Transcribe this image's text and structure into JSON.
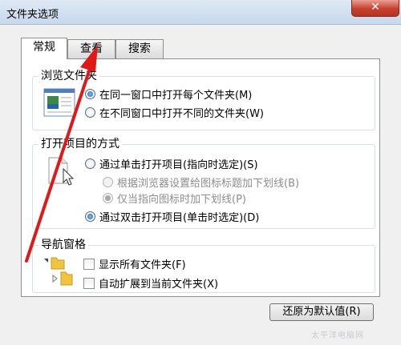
{
  "window": {
    "title": "文件夹选项",
    "close_glyph": "✕"
  },
  "tabs": [
    {
      "label": "常规",
      "active": true
    },
    {
      "label": "查看",
      "active": false
    },
    {
      "label": "搜索",
      "active": false
    }
  ],
  "browse_group": {
    "legend": "浏览文件夹",
    "options": [
      {
        "label": "在同一窗口中打开每个文件夹(M)",
        "selected": true
      },
      {
        "label": "在不同窗口中打开不同的文件夹(W)",
        "selected": false
      }
    ]
  },
  "click_group": {
    "legend": "打开项目的方式",
    "single_click": {
      "label": "通过单击打开项目(指向时选定)(S)",
      "selected": false
    },
    "sub_options": [
      {
        "label": "根据浏览器设置给图标标题加下划线(B)",
        "selected": false,
        "disabled": true
      },
      {
        "label": "仅当指向图标时加下划线(P)",
        "selected": true,
        "disabled": true
      }
    ],
    "double_click": {
      "label": "通过双击打开项目(单击时选定)(D)",
      "selected": true
    }
  },
  "nav_group": {
    "legend": "导航窗格",
    "checkboxes": [
      {
        "label": "显示所有文件夹(F)",
        "checked": false
      },
      {
        "label": "自动扩展到当前文件夹(X)",
        "checked": false
      }
    ]
  },
  "restore_button": {
    "label": "还原为默认值(R)"
  },
  "colors": {
    "annotation_arrow": "#e01818",
    "titlebar": "#c6d8ec",
    "close_button": "#c7402e"
  },
  "watermark": "太平洋电脑网"
}
